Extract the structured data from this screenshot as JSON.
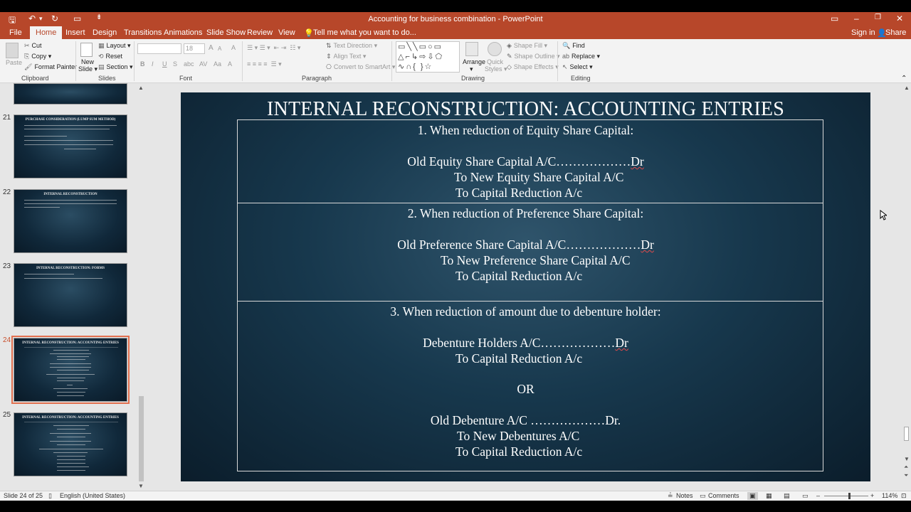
{
  "window": {
    "title": "Accounting for business combination - PowerPoint",
    "controls": {
      "restore_ribbon": "▭",
      "minimize": "–",
      "maximize": "❐",
      "close": "✕"
    }
  },
  "quick_access": {
    "save": "🖫",
    "undo": "↶",
    "undo_drop": "▾",
    "redo": "↻",
    "present": "▭",
    "customize": "⇟"
  },
  "tabs": [
    "File",
    "Home",
    "Insert",
    "Design",
    "Transitions",
    "Animations",
    "Slide Show",
    "Review",
    "View"
  ],
  "active_tab": "Home",
  "tell_me": "Tell me what you want to do...",
  "signin": "Sign in",
  "share": "Share",
  "ribbon": {
    "clipboard": {
      "label": "Clipboard",
      "paste": "Paste",
      "cut": "Cut",
      "copy": "Copy",
      "format_painter": "Format Painter"
    },
    "slides": {
      "label": "Slides",
      "new_slide": "New",
      "new_slide2": "Slide",
      "layout": "Layout",
      "reset": "Reset",
      "section": "Section"
    },
    "font": {
      "label": "Font",
      "font_name": "",
      "font_size": "18",
      "bold": "B",
      "italic": "I",
      "underline": "U",
      "strike": "S",
      "shadow": "abc",
      "spacing": "AV",
      "case": "Aa",
      "color": "A",
      "grow": "A",
      "shrink": "A",
      "clear": "A"
    },
    "paragraph": {
      "label": "Paragraph",
      "text_direction": "Text Direction",
      "align_text": "Align Text",
      "convert_smartart": "Convert to SmartArt"
    },
    "drawing": {
      "label": "Drawing",
      "arrange": "Arrange",
      "quick_styles": "Quick",
      "quick_styles2": "Styles",
      "shape_fill": "Shape Fill",
      "shape_outline": "Shape Outline",
      "shape_effects": "Shape Effects"
    },
    "editing": {
      "label": "Editing",
      "find": "Find",
      "replace": "Replace",
      "select": "Select"
    }
  },
  "thumbnails": [
    {
      "num": "",
      "title": ""
    },
    {
      "num": "21",
      "title": "PURCHASE CONSIDERATION (LUMP SUM METHOD)"
    },
    {
      "num": "22",
      "title": "INTERNAL RECONSTRUCTION"
    },
    {
      "num": "23",
      "title": "INTERNAL RECONSTRUCTION: FORMS"
    },
    {
      "num": "24",
      "title": "INTERNAL RECONSTRUCTION: ACCOUNTING ENTRIES"
    },
    {
      "num": "25",
      "title": "INTERNAL RECONSTRUCTION: ACCOUNTING ENTRIES"
    }
  ],
  "slide": {
    "title": "INTERNAL RECONSTRUCTION: ACCOUNTING ENTRIES",
    "s1": {
      "heading": "1.   When reduction of Equity Share Capital:",
      "line1": "Old Equity Share Capital A/C………………",
      "line1_dr": "Dr",
      "line2": "To New Equity Share Capital A/C",
      "line3": "To Capital Reduction A/c"
    },
    "s2": {
      "heading": "2. When reduction of Preference Share Capital:",
      "line1": "Old Preference Share Capital A/C………………",
      "line1_dr": "Dr",
      "line2": "To New Preference Share Capital A/C",
      "line3": "To Capital Reduction A/c"
    },
    "s3": {
      "heading": "3. When reduction of amount due to debenture holder:",
      "line1": "Debenture Holders A/C………………",
      "line1_dr": "Dr",
      "line2": "To Capital Reduction A/c",
      "or": "OR",
      "line3": "Old Debenture A/C ………………Dr.",
      "line4": "To New Debentures A/C",
      "line5": "To Capital Reduction A/c"
    }
  },
  "status": {
    "slide_info": "Slide 24 of 25",
    "language": "English (United States)",
    "notes": "Notes",
    "comments": "Comments",
    "zoom_minus": "–",
    "zoom_plus": "+",
    "zoom": "114%",
    "zoom_level": 0.57
  }
}
